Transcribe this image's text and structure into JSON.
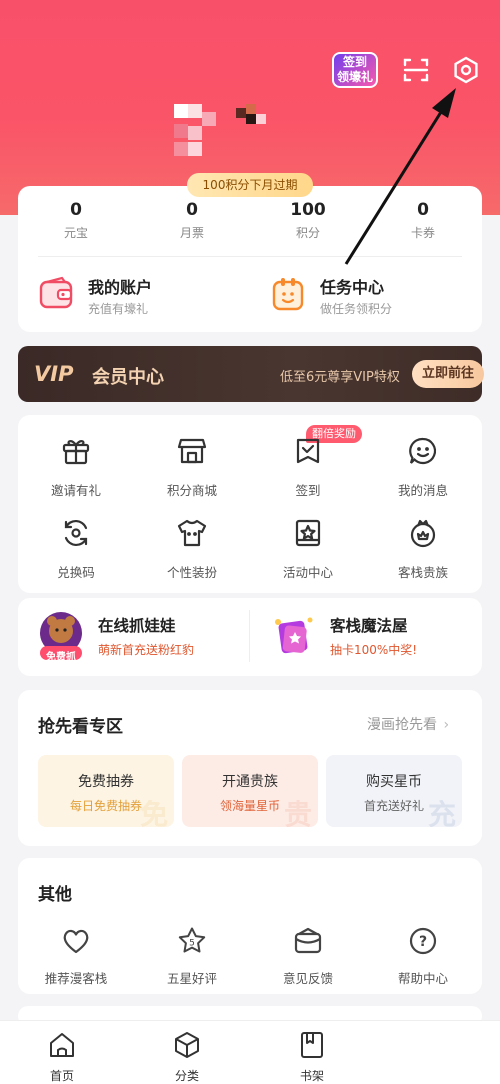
{
  "header": {
    "checkin_badge": [
      "签到",
      "领壕礼"
    ],
    "expire_notice": "100积分下月过期",
    "icons": [
      "scan-icon",
      "settings-icon"
    ]
  },
  "stats": [
    {
      "value": "0",
      "label": "元宝"
    },
    {
      "value": "0",
      "label": "月票"
    },
    {
      "value": "100",
      "label": "积分"
    },
    {
      "value": "0",
      "label": "卡券"
    }
  ],
  "account": {
    "title": "我的账户",
    "subtitle": "充值有壕礼"
  },
  "tasks": {
    "title": "任务中心",
    "subtitle": "做任务领积分"
  },
  "vip": {
    "logo": "VIP",
    "title": "会员中心",
    "desc": "低至6元尊享VIP特权",
    "button": "立即前往"
  },
  "grid": {
    "double_tag": "翻倍奖励",
    "items": [
      {
        "label": "邀请有礼",
        "icon": "gift-icon"
      },
      {
        "label": "积分商城",
        "icon": "store-icon"
      },
      {
        "label": "签到",
        "icon": "checkin-icon"
      },
      {
        "label": "我的消息",
        "icon": "message-icon"
      },
      {
        "label": "兑换码",
        "icon": "redeem-code-icon"
      },
      {
        "label": "个性装扮",
        "icon": "outfit-icon"
      },
      {
        "label": "活动中心",
        "icon": "activity-icon"
      },
      {
        "label": "客栈贵族",
        "icon": "noble-icon"
      }
    ]
  },
  "promos": [
    {
      "title": "在线抓娃娃",
      "subtitle": "萌新首充送粉红豹",
      "badge": "免费抓"
    },
    {
      "title": "客栈魔法屋",
      "subtitle": "抽卡100%中奖!"
    }
  ],
  "preview": {
    "title": "抢先看专区",
    "more": "漫画抢先看",
    "boxes": [
      {
        "title": "免费抽券",
        "subtitle": "每日免费抽券",
        "watermark": "免",
        "color": "#e3a03a"
      },
      {
        "title": "开通贵族",
        "subtitle": "领海量星币",
        "watermark": "贵",
        "color": "#e0633a"
      },
      {
        "title": "购买星币",
        "subtitle": "首充送好礼",
        "watermark": "充",
        "color": "#666666"
      }
    ]
  },
  "other": {
    "title": "其他",
    "items": [
      {
        "label": "推荐漫客栈",
        "icon": "heart-icon"
      },
      {
        "label": "五星好评",
        "icon": "five-star-icon",
        "glyph": "5"
      },
      {
        "label": "意见反馈",
        "icon": "feedback-icon"
      },
      {
        "label": "帮助中心",
        "icon": "help-icon",
        "glyph": "?"
      }
    ]
  },
  "tabbar": [
    {
      "label": "首页",
      "icon": "home-icon"
    },
    {
      "label": "分类",
      "icon": "category-icon"
    },
    {
      "label": "书架",
      "icon": "bookshelf-icon"
    }
  ]
}
